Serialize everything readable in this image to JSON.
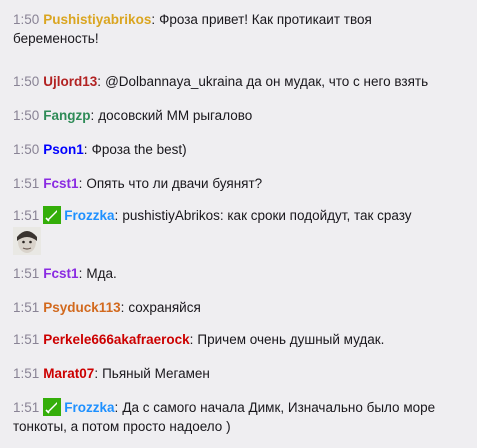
{
  "messages": [
    {
      "time": "1:50",
      "user": "Pushistiyabrikos",
      "color": "#daa520",
      "text_lines": [
        "Фроза привет! Как протикаит твоя",
        "беременость!"
      ]
    },
    {
      "time": "1:50",
      "user": "Ujlord13",
      "color": "#b22222",
      "text": "@Dolbannaya_ukraina да он мудак, что с него взять"
    },
    {
      "time": "1:50",
      "user": "Fangzp",
      "color": "#2e8b57",
      "text": "досовский ММ рыгалово"
    },
    {
      "time": "1:50",
      "user": "Pson1",
      "color": "#0000ff",
      "text": "Фроза the best)"
    },
    {
      "time": "1:51",
      "user": "Fcst1",
      "color": "#8a2be2",
      "text": "Опять что ли двачи буянят?"
    },
    {
      "time": "1:51",
      "user": "Frozzka",
      "color": "#1e90ff",
      "badge": "moderator-sword-icon",
      "text": "pushistiyAbrikos: как сроки подойдут, так сразу",
      "emote": "face-emote"
    },
    {
      "time": "1:51",
      "user": "Fcst1",
      "color": "#8a2be2",
      "text": "Мда."
    },
    {
      "time": "1:51",
      "user": "Psyduck113",
      "color": "#d2691e",
      "text": "сохраняйся"
    },
    {
      "time": "1:51",
      "user": "Perkele666akafraerock",
      "color": "#cc0000",
      "text": "Причем очень душный мудак."
    },
    {
      "time": "1:51",
      "user": "Marat07",
      "color": "#cc0000",
      "text": "Пьяный Мегамен"
    },
    {
      "time": "1:51",
      "user": "Frozzka",
      "color": "#1e90ff",
      "badge": "moderator-sword-icon",
      "text_lines": [
        "Да с самого начала Димк, Изначально было море",
        "тонкоты, а потом просто надоело )"
      ]
    }
  ]
}
